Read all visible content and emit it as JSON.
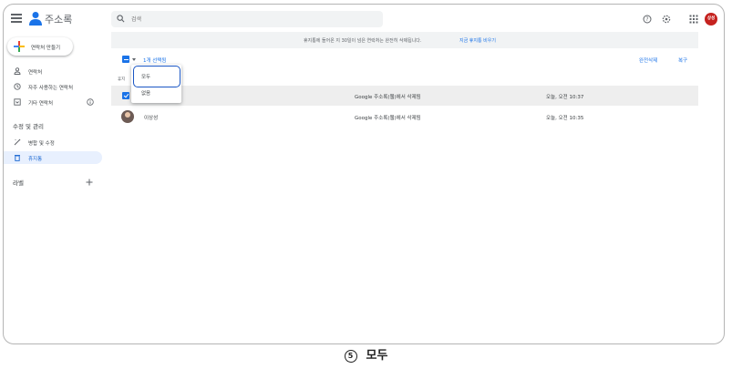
{
  "header": {
    "app_title": "주소록",
    "search_placeholder": "검색",
    "avatar_initials": "상성",
    "avatar_color": "#c5221f"
  },
  "sidebar": {
    "create_label": "연락처 만들기",
    "items": [
      {
        "label": "연락처",
        "icon": "person-icon"
      },
      {
        "label": "자주 사용하는 연락처",
        "icon": "history-icon"
      },
      {
        "label": "기타 연락처",
        "icon": "contact-download-icon"
      }
    ],
    "section_fix": "수정 및 관리",
    "fix_items": [
      {
        "label": "병합 및 수정",
        "icon": "auto-fix-icon"
      },
      {
        "label": "휴지통",
        "icon": "trash-icon",
        "active": true
      }
    ],
    "labels_title": "라벨"
  },
  "main": {
    "banner_text": "휴지통에 들어온 지 30일이 넘은 연락처는 완전히 삭제됩니다.",
    "banner_link": "지금 휴지통 비우기",
    "selected_count": "1개 선택됨",
    "delete_forever": "완전삭제",
    "restore": "복구",
    "column_label": "휴지",
    "rows": [
      {
        "name": "",
        "reason": "Google 주소록(웹)에서 삭제됨",
        "time": "오늘, 오전 10:37",
        "selected": true
      },
      {
        "name": "이상성",
        "reason": "Google 주소록(웹)에서 삭제됨",
        "time": "오늘, 오전 10:35",
        "selected": false
      }
    ]
  },
  "dropdown": {
    "items": [
      "모두",
      "없음"
    ],
    "highlighted": "모두"
  },
  "caption": {
    "number": "5",
    "text": "모두"
  },
  "colors": {
    "accent": "#1a73e8",
    "highlight_border": "#1a56c4",
    "active_nav_bg": "#e8f0fe"
  }
}
